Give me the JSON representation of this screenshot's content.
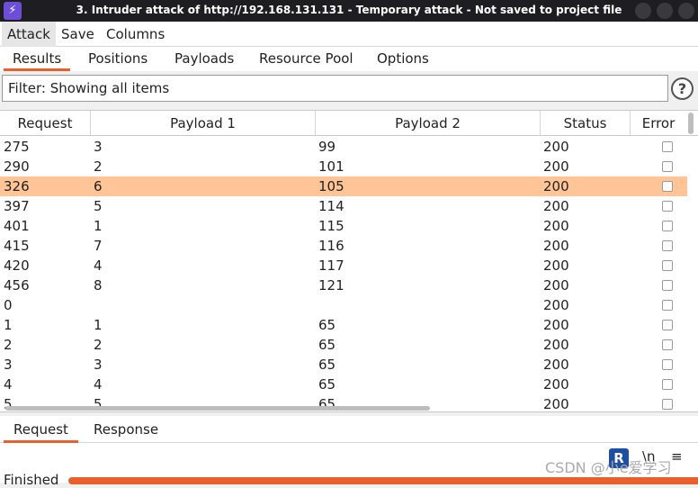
{
  "window": {
    "title": "3. Intruder attack of http://192.168.131.131 - Temporary attack - Not saved to project file"
  },
  "menu": [
    "Attack",
    "Save",
    "Columns"
  ],
  "tabs": [
    "Results",
    "Positions",
    "Payloads",
    "Resource Pool",
    "Options"
  ],
  "filter": {
    "text": "Filter: Showing all items",
    "help": "?"
  },
  "table": {
    "columns": [
      "Request",
      "Payload 1",
      "Payload 2",
      "Status",
      "Error"
    ],
    "rows": [
      [
        "275",
        "3",
        "99",
        "200"
      ],
      [
        "290",
        "2",
        "101",
        "200"
      ],
      [
        "326",
        "6",
        "105",
        "200"
      ],
      [
        "397",
        "5",
        "114",
        "200"
      ],
      [
        "401",
        "1",
        "115",
        "200"
      ],
      [
        "415",
        "7",
        "116",
        "200"
      ],
      [
        "420",
        "4",
        "117",
        "200"
      ],
      [
        "456",
        "8",
        "121",
        "200"
      ],
      [
        "0",
        "",
        "",
        "200"
      ],
      [
        "1",
        "1",
        "65",
        "200"
      ],
      [
        "2",
        "2",
        "65",
        "200"
      ],
      [
        "3",
        "3",
        "65",
        "200"
      ],
      [
        "4",
        "4",
        "65",
        "200"
      ],
      [
        "5",
        "5",
        "65",
        "200"
      ]
    ],
    "selected_row": 2
  },
  "bottom_tabs": [
    "Request",
    "Response"
  ],
  "editor_tools": {
    "r": "R",
    "ln": "\\n",
    "menu": "≡"
  },
  "watermark": "CSDN @小e爱学习",
  "status": {
    "text": "Finished",
    "progress": 1.0
  },
  "colors": {
    "accent": "#e8612c",
    "highlight": "#ffc597",
    "titlebar": "#1e1e22"
  }
}
